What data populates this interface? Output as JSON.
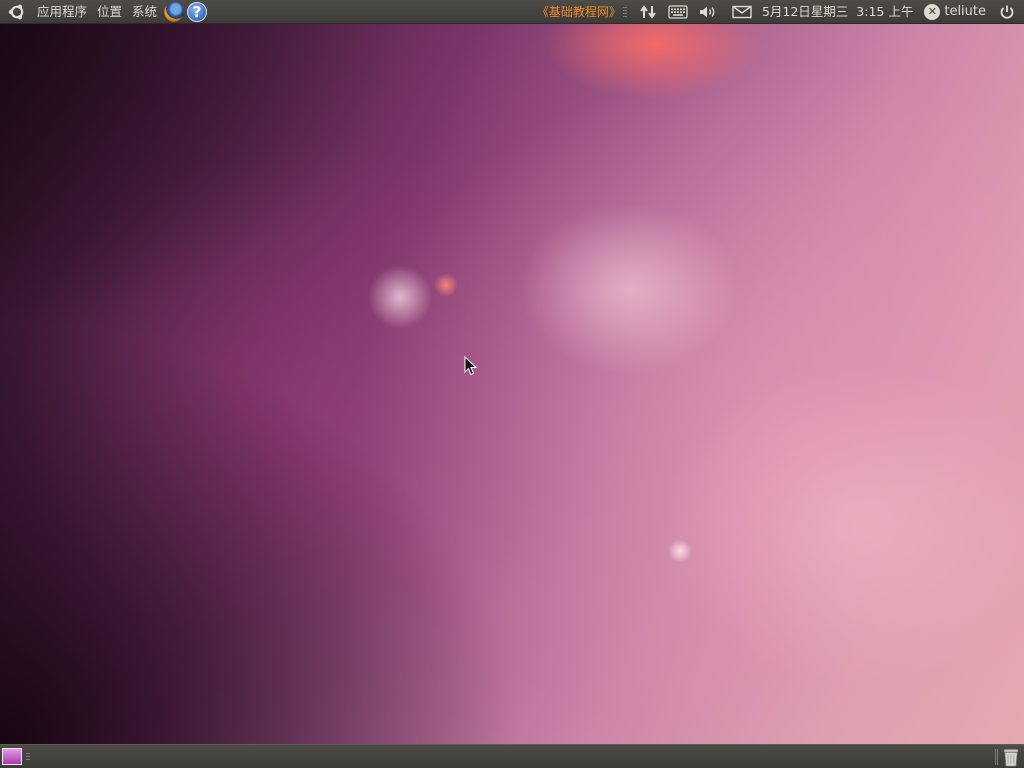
{
  "top_panel": {
    "menus": {
      "applications": "应用程序",
      "places": "位置",
      "system": "系统"
    },
    "launchers": [
      "firefox-icon",
      "help-icon"
    ],
    "help_glyph": "?",
    "brand": "《基础教程网》",
    "tray_icons": [
      "network-icon",
      "keyboard-icon",
      "volume-icon",
      "mail-icon"
    ],
    "date": "5月12日星期三",
    "time": "3:15 上午",
    "user_status_glyph": "✕",
    "user": "teliute",
    "power_icon": "power-icon"
  },
  "bottom_panel": {
    "left_icon": "show-desktop-icon",
    "right_icon": "trash-icon"
  },
  "colors": {
    "panel": "#3c3b37",
    "panel_text": "#dfdbd2",
    "brand_text": "#f08a2c"
  }
}
